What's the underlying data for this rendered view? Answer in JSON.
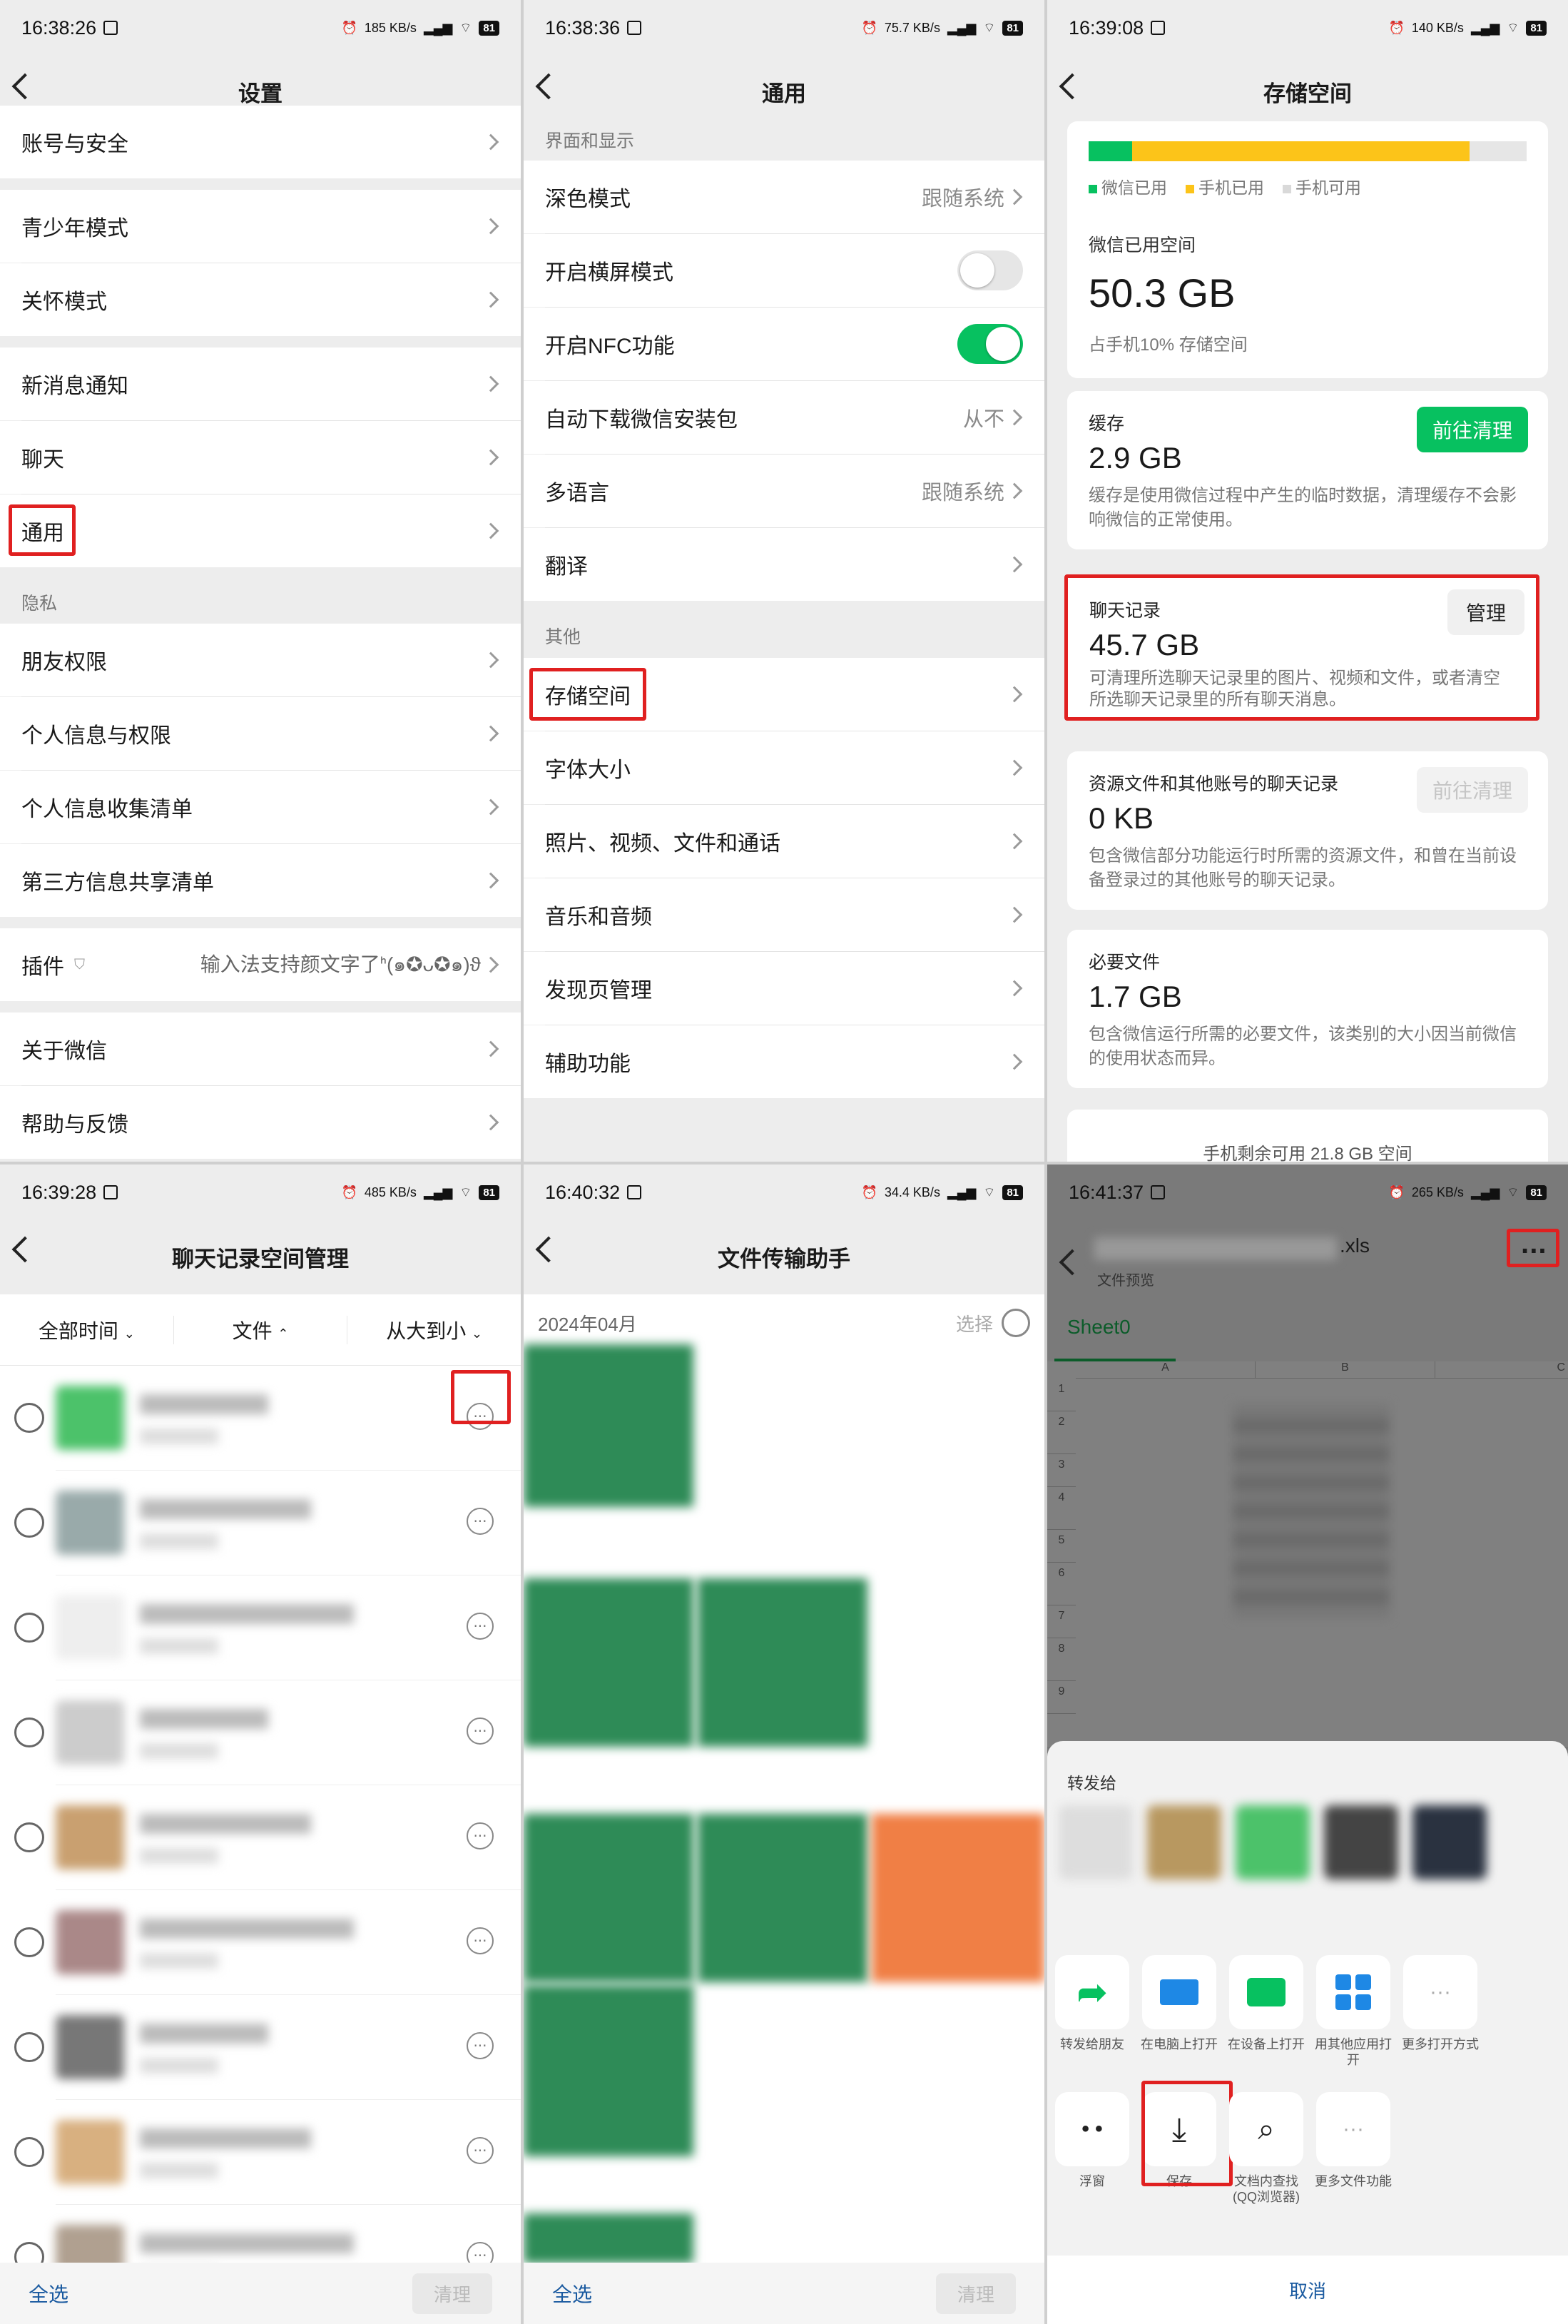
{
  "panel1": {
    "time": "16:38:26",
    "net": "185 KB/s",
    "battery": "81",
    "title": "设置",
    "rows": [
      {
        "label": "账号与安全"
      },
      {
        "label": "青少年模式"
      },
      {
        "label": "关怀模式"
      },
      {
        "label": "新消息通知"
      },
      {
        "label": "聊天"
      },
      {
        "label": "通用"
      },
      {
        "label": "朋友权限"
      },
      {
        "label": "个人信息与权限"
      },
      {
        "label": "个人信息收集清单"
      },
      {
        "label": "第三方信息共享清单"
      },
      {
        "label": "插件",
        "value": "输入法支持颜文字了ᑋ(๑✪ᴗ✪๑)ϑ"
      },
      {
        "label": "关于微信"
      },
      {
        "label": "帮助与反馈"
      }
    ],
    "section_privacy": "隐私"
  },
  "panel2": {
    "time": "16:38:36",
    "net": "75.7 KB/s",
    "battery": "81",
    "title": "通用",
    "section_display": "界面和显示",
    "section_other": "其他",
    "rows": [
      {
        "label": "深色模式",
        "value": "跟随系统"
      },
      {
        "label": "开启横屏模式"
      },
      {
        "label": "开启NFC功能"
      },
      {
        "label": "自动下载微信安装包",
        "value": "从不"
      },
      {
        "label": "多语言",
        "value": "跟随系统"
      },
      {
        "label": "翻译"
      },
      {
        "label": "存储空间"
      },
      {
        "label": "字体大小"
      },
      {
        "label": "照片、视频、文件和通话"
      },
      {
        "label": "音乐和音频"
      },
      {
        "label": "发现页管理"
      },
      {
        "label": "辅助功能"
      }
    ],
    "toggles": {
      "landscape": false,
      "nfc": true
    }
  },
  "panel3": {
    "time": "16:39:08",
    "net": "140 KB/s",
    "battery": "81",
    "title": "存储空间",
    "bar": {
      "wechat_fraction": 0.1,
      "phone_used_fraction": 0.87,
      "wechat_color": "#07c160",
      "phone_color": "#fcc419",
      "free_color": "#e6e6e6"
    },
    "legend": [
      "微信已用",
      "手机已用",
      "手机可用"
    ],
    "used_label": "微信已用空间",
    "used_value": "50.3 GB",
    "used_desc": "占手机10% 存储空间",
    "cards": [
      {
        "title": "缓存",
        "size": "2.9 GB",
        "desc": "缓存是使用微信过程中产生的临时数据，清理缓存不会影响微信的正常使用。",
        "button": "前往清理"
      },
      {
        "title": "聊天记录",
        "size": "45.7 GB",
        "desc": "可清理所选聊天记录里的图片、视频和文件，或者清空所选聊天记录里的所有聊天消息。",
        "button": "管理"
      },
      {
        "title": "资源文件和其他账号的聊天记录",
        "size": "0 KB",
        "desc": "包含微信部分功能运行时所需的资源文件，和曾在当前设备登录过的其他账号的聊天记录。",
        "button": "前往清理"
      },
      {
        "title": "必要文件",
        "size": "1.7 GB",
        "desc": "包含微信运行所需的必要文件，该类别的大小因当前微信的使用状态而异。"
      }
    ],
    "footer": "手机剩余可用 21.8 GB 空间"
  },
  "panel4": {
    "time": "16:39:28",
    "net": "485 KB/s",
    "battery": "81",
    "title": "聊天记录空间管理",
    "filters": [
      "全部时间",
      "文件",
      "从大到小"
    ],
    "select_all": "全选",
    "clean": "清理",
    "more_icon": "···"
  },
  "panel5": {
    "time": "16:40:32",
    "net": "34.4 KB/s",
    "battery": "81",
    "title": "文件传输助手",
    "month": "2024年04月",
    "select": "选择",
    "select_all": "全选",
    "clean": "清理"
  },
  "panel6": {
    "time": "16:41:37",
    "net": "265 KB/s",
    "battery": "81",
    "file_ext": ".xls",
    "file_sub": "文件预览",
    "sheet_tab": "Sheet0",
    "columns": [
      "A",
      "B",
      "C"
    ],
    "row_numbers": [
      "1",
      "2",
      "3",
      "4",
      "5",
      "6",
      "7",
      "8",
      "9"
    ],
    "forward_to": "转发给",
    "actions_row1": [
      "转发给朋友",
      "在电脑上打开",
      "在设备上打开",
      "用其他应用打开",
      "更多打开方式"
    ],
    "actions_row2": [
      "浮窗",
      "保存",
      "文档内查找(QQ浏览器)",
      "更多文件功能"
    ],
    "cancel": "取消",
    "more_icon": "···"
  }
}
